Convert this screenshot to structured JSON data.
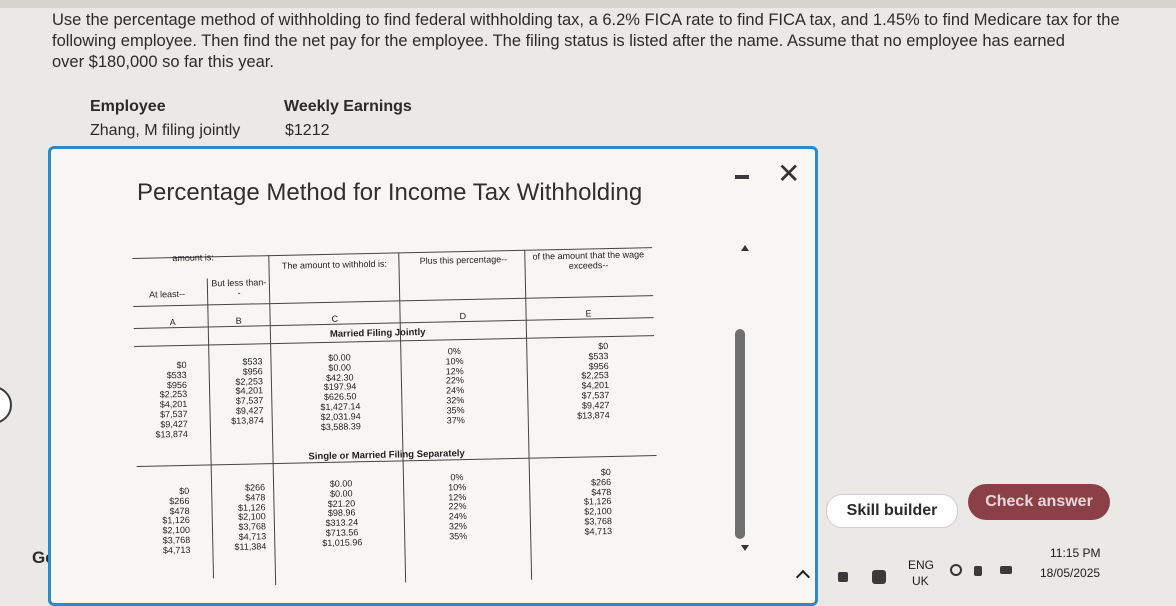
{
  "question": {
    "line1": "Use the percentage method of withholding to find federal withholding tax, a 6.2% FICA rate to find FICA tax, and 1.45% to find Medicare tax for the",
    "line2": "following employee. Then find the net pay for the employee. The filing status is listed after the name. Assume that no employee has earned",
    "line3": "over $180,000 so far this year."
  },
  "employee": {
    "col_employee": "Employee",
    "col_weekly": "Weekly Earnings",
    "name": "Zhang, M filing jointly",
    "earnings": "$1212"
  },
  "get_text": "Get",
  "popup": {
    "title": "Percentage Method for Income Tax Withholding",
    "table": {
      "hdr_amount": "amount is:",
      "hdr_atleast": "At least--",
      "hdr_butless": "But less than--",
      "hdr_withhold": "The amount to withhold is:",
      "hdr_plus": "Plus this percentage--",
      "hdr_exceeds": "of the amount that the wage exceeds--",
      "letters": [
        "A",
        "B",
        "C",
        "D",
        "E"
      ],
      "married_title": "Married Filing Jointly",
      "married": {
        "a": [
          "$0",
          "$533",
          "$956",
          "$2,253",
          "$4,201",
          "$7,537",
          "$9,427",
          "$13,874"
        ],
        "b": [
          "$533",
          "$956",
          "$2,253",
          "$4,201",
          "$7,537",
          "$9,427",
          "$13,874"
        ],
        "c": [
          "$0.00",
          "$0.00",
          "$42.30",
          "$197.94",
          "$626.50",
          "$1,427.14",
          "$2,031.94",
          "$3,588.39"
        ],
        "d": [
          "0%",
          "10%",
          "12%",
          "22%",
          "24%",
          "32%",
          "35%",
          "37%"
        ],
        "e": [
          "$0",
          "$533",
          "$956",
          "$2,253",
          "$4,201",
          "$7,537",
          "$9,427",
          "$13,874"
        ]
      },
      "single_title": "Single or Married Filing Separately",
      "single": {
        "a": [
          "$0",
          "$266",
          "$478",
          "$1,126",
          "$2,100",
          "$3,768",
          "$4,713"
        ],
        "b": [
          "$266",
          "$478",
          "$1,126",
          "$2,100",
          "$3,768",
          "$4,713",
          "$11,384"
        ],
        "c": [
          "$0.00",
          "$0.00",
          "$21.20",
          "$98.96",
          "$313.24",
          "$713.56",
          "$1,015.96"
        ],
        "d": [
          "0%",
          "10%",
          "12%",
          "22%",
          "24%",
          "32%",
          "35%"
        ],
        "e": [
          "$0",
          "$266",
          "$478",
          "$1,126",
          "$2,100",
          "$3,768",
          "$4,713"
        ]
      }
    }
  },
  "buttons": {
    "skill": "Skill builder",
    "check": "Check answer"
  },
  "taskbar": {
    "lang": "ENG",
    "region": "UK",
    "time": "11:15 PM",
    "date": "18/05/2025"
  }
}
